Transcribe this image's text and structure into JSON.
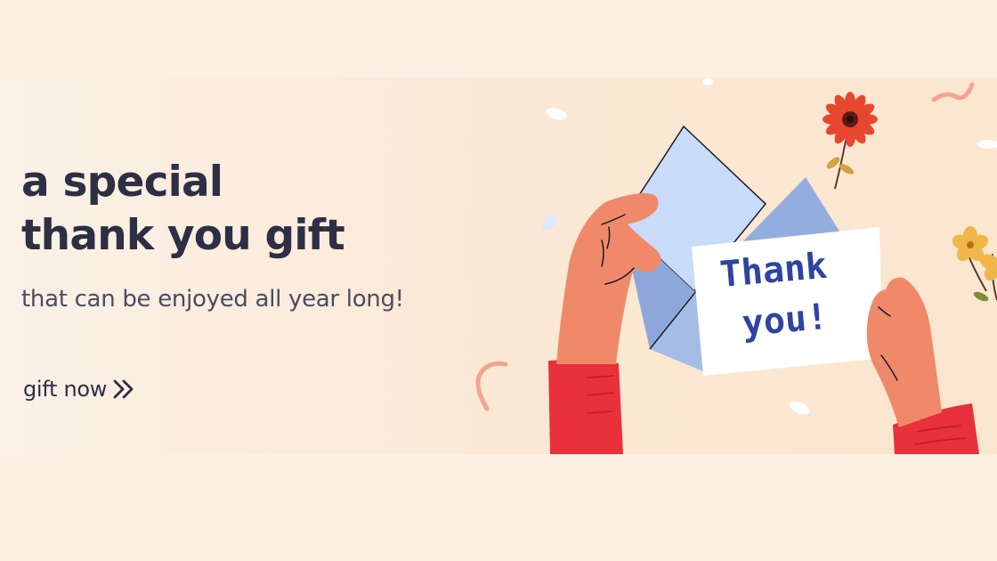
{
  "banner": {
    "headline_line1": "a special",
    "headline_line2": "thank you gift",
    "subtitle": "that can be enjoyed all year long!",
    "cta_label": "gift now",
    "cta_icon": "double-chevron-right-icon",
    "card_line1": "Thank",
    "card_line2": "you!"
  },
  "colors": {
    "page_background": "#fcf0e3",
    "banner_background": "#fbe8d4",
    "text": "#2d2f44",
    "subtitle_text": "#4a4c60",
    "skin": "#f0896a",
    "sleeve": "#e8313a",
    "envelope": "#a5bce6",
    "card_text": "#2f43a3",
    "flower_red": "#e8472f",
    "flower_yellow": "#f1b649"
  }
}
